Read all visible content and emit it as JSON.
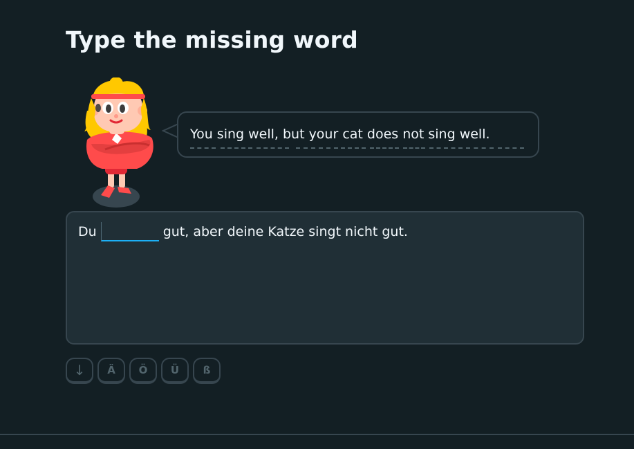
{
  "page": {
    "title": "Type the missing word"
  },
  "prompt": {
    "character_icon": "lily-character",
    "speech_text": "You sing well, but your cat does not sing well."
  },
  "exercise": {
    "before_blank": "Du",
    "blank_value": "",
    "after_blank": "gut, aber deine Katze singt nicht gut."
  },
  "keyboard": {
    "toggle_icon": "arrow-down-icon",
    "toggle_label": "↓",
    "special_keys": [
      "Ä",
      "Ö",
      "Ü",
      "ß"
    ]
  },
  "colors": {
    "background": "#131f24",
    "border": "#37464f",
    "input_box": "#202f36",
    "blank_underline": "#1cb0f6",
    "text": "#f1f7fb",
    "muted": "#52656d"
  }
}
